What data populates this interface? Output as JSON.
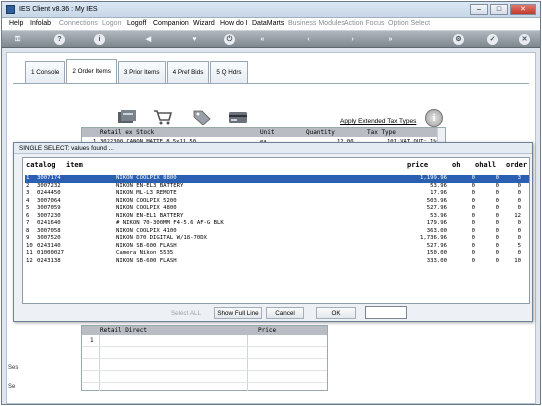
{
  "window": {
    "title": "IES Client v8.36 : My IES"
  },
  "menu": {
    "items": [
      {
        "label": "Help",
        "enabled": true
      },
      {
        "label": "Infolab",
        "enabled": true
      },
      {
        "label": "Connections",
        "enabled": false
      },
      {
        "label": "Logon",
        "enabled": false
      },
      {
        "label": "Logoff",
        "enabled": true
      },
      {
        "label": "Companion",
        "enabled": true
      },
      {
        "label": "Wizard",
        "enabled": true
      },
      {
        "label": "How do I",
        "enabled": true
      },
      {
        "label": "DataMarts",
        "enabled": true
      },
      {
        "label": "Business Modules",
        "enabled": false
      },
      {
        "label": "Action Focus",
        "enabled": false
      },
      {
        "label": "Option Select",
        "enabled": false
      }
    ]
  },
  "toolbar": {
    "icons": [
      "key-icon",
      "help-icon",
      "info-icon",
      "back-icon",
      "home-icon",
      "power-icon",
      "rewind-icon",
      "prev-icon",
      "next-icon",
      "forward-icon",
      "settings-icon",
      "check-icon",
      "close-icon"
    ]
  },
  "tabs": [
    {
      "label": "1 Console",
      "active": false
    },
    {
      "label": "2 Order Items",
      "active": true
    },
    {
      "label": "3 Prior Items",
      "active": false
    },
    {
      "label": "4 Pref Bids",
      "active": false
    },
    {
      "label": "5 Q Hdrs",
      "active": false
    }
  ],
  "actions": {
    "apply_link": "Apply Extended Tax Types",
    "info_glyph": "i"
  },
  "stock_grid": {
    "columns": [
      "Retail ex Stock",
      "Unit",
      "Quantity",
      "Tax Type"
    ],
    "row": {
      "num": "1",
      "item": "3022300 CANON MATTE 8.5x11 50",
      "unit": "ea",
      "quantity": "12.00",
      "tax": "101 VAT OUT: 1%"
    }
  },
  "direct_grid": {
    "columns": [
      "Retail Direct",
      "Price"
    ],
    "row_num": "1"
  },
  "side_labels": [
    "Ses",
    "Se"
  ],
  "dialog": {
    "title": "SINGLE SELECT: values found ...",
    "columns": {
      "catalog": "catalog",
      "item": "item",
      "price": "price",
      "oh": "oh",
      "ohall": "ohall",
      "order": "order"
    },
    "rows": [
      {
        "num": "1",
        "code": "3007174",
        "desc": "NIKON COOLPIX 8800",
        "price": "1,199.96",
        "oh": "0",
        "ohall": "0",
        "order": "3",
        "selected": true
      },
      {
        "num": "2",
        "code": "3007232",
        "desc": "NIKON EN-EL3 BATTERY",
        "price": "53.96",
        "oh": "0",
        "ohall": "0",
        "order": "0",
        "selected": false
      },
      {
        "num": "3",
        "code": "0244450",
        "desc": "NIKON ML-L3 REMOTE",
        "price": "17.96",
        "oh": "0",
        "ohall": "0",
        "order": "0",
        "selected": false
      },
      {
        "num": "4",
        "code": "3007064",
        "desc": "NIKON COOLPIX 5200",
        "price": "503.96",
        "oh": "0",
        "ohall": "0",
        "order": "0",
        "selected": false
      },
      {
        "num": "5",
        "code": "3007059",
        "desc": "NIKON COOLPIX 4800",
        "price": "527.96",
        "oh": "0",
        "ohall": "0",
        "order": "0",
        "selected": false
      },
      {
        "num": "6",
        "code": "3007230",
        "desc": "NIKON EN-EL1 BATTERY",
        "price": "53.96",
        "oh": "0",
        "ohall": "0",
        "order": "12",
        "selected": false
      },
      {
        "num": "7",
        "code": "0241640",
        "desc": "# NIKON 70-300MM F4-5.6 AF-G BLK",
        "price": "179.96",
        "oh": "0",
        "ohall": "0",
        "order": "0",
        "selected": false
      },
      {
        "num": "8",
        "code": "3007058",
        "desc": "NIKON COOLPIX 4100",
        "price": "363.00",
        "oh": "0",
        "ohall": "0",
        "order": "0",
        "selected": false
      },
      {
        "num": "9",
        "code": "3007520",
        "desc": "NIKON D70 DIGITAL W/18-70DX",
        "price": "1,736.96",
        "oh": "0",
        "ohall": "0",
        "order": "0",
        "selected": false
      },
      {
        "num": "10",
        "code": "0243140",
        "desc": "NIKON SB-600 FLASH",
        "price": "527.96",
        "oh": "0",
        "ohall": "0",
        "order": "5",
        "selected": false
      },
      {
        "num": "11",
        "code": "01000027",
        "desc": "Camera Nikon 5535",
        "price": "150.00",
        "oh": "0",
        "ohall": "0",
        "order": "0",
        "selected": false
      },
      {
        "num": "12",
        "code": "0243138",
        "desc": "NIKON SB-600 FLASH",
        "price": "333.00",
        "oh": "0",
        "ohall": "0",
        "order": "10",
        "selected": false
      }
    ],
    "buttons": {
      "select_all": "Select ALL",
      "show_full_line": "Show Full Line",
      "cancel": "Cancel",
      "ok": "OK"
    },
    "input_value": ""
  },
  "colors": {
    "selected_row": "#2b5fb1",
    "toolbar": "#8a929b",
    "grid_header": "#b9bdc3"
  }
}
